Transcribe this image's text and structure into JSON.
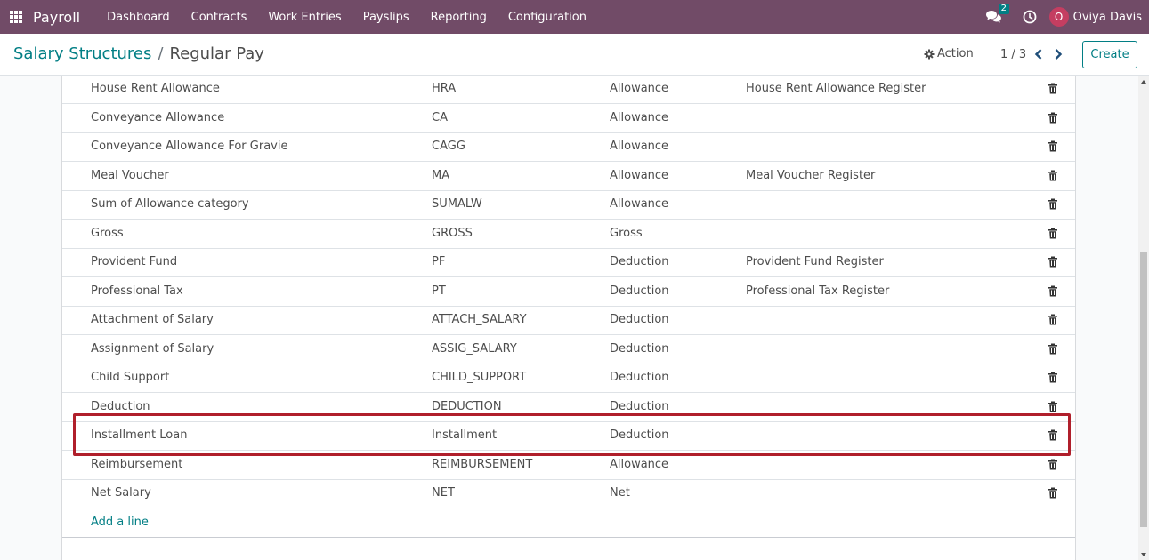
{
  "navbar": {
    "brand": "Payroll",
    "menu": [
      "Dashboard",
      "Contracts",
      "Work Entries",
      "Payslips",
      "Reporting",
      "Configuration"
    ],
    "chat_count": "2",
    "user_initial": "O",
    "user_name": "Oviya Davis"
  },
  "control_panel": {
    "breadcrumb_parent": "Salary Structures",
    "breadcrumb_separator": "/",
    "breadcrumb_current": "Regular Pay",
    "action_label": "Action",
    "pager": "1 / 3",
    "create_label": "Create"
  },
  "rules": [
    {
      "name": "House Rent Allowance",
      "code": "HRA",
      "category": "Allowance",
      "register": "House Rent Allowance Register"
    },
    {
      "name": "Conveyance Allowance",
      "code": "CA",
      "category": "Allowance",
      "register": ""
    },
    {
      "name": "Conveyance Allowance For Gravie",
      "code": "CAGG",
      "category": "Allowance",
      "register": ""
    },
    {
      "name": "Meal Voucher",
      "code": "MA",
      "category": "Allowance",
      "register": "Meal Voucher Register"
    },
    {
      "name": "Sum of Allowance category",
      "code": "SUMALW",
      "category": "Allowance",
      "register": ""
    },
    {
      "name": "Gross",
      "code": "GROSS",
      "category": "Gross",
      "register": ""
    },
    {
      "name": "Provident Fund",
      "code": "PF",
      "category": "Deduction",
      "register": "Provident Fund Register"
    },
    {
      "name": "Professional Tax",
      "code": "PT",
      "category": "Deduction",
      "register": "Professional Tax Register"
    },
    {
      "name": "Attachment of Salary",
      "code": "ATTACH_SALARY",
      "category": "Deduction",
      "register": ""
    },
    {
      "name": "Assignment of Salary",
      "code": "ASSIG_SALARY",
      "category": "Deduction",
      "register": ""
    },
    {
      "name": "Child Support",
      "code": "CHILD_SUPPORT",
      "category": "Deduction",
      "register": ""
    },
    {
      "name": "Deduction",
      "code": "DEDUCTION",
      "category": "Deduction",
      "register": ""
    },
    {
      "name": "Installment Loan",
      "code": "Installment",
      "category": "Deduction",
      "register": ""
    },
    {
      "name": "Reimbursement",
      "code": "REIMBURSEMENT",
      "category": "Allowance",
      "register": ""
    },
    {
      "name": "Net Salary",
      "code": "NET",
      "category": "Net",
      "register": ""
    }
  ],
  "add_line_label": "Add a line",
  "colors": {
    "navbar": "#714b67",
    "accent": "#017e84",
    "highlight": "#b01f2b"
  },
  "icons": {
    "apps": "apps-grid-icon",
    "chat": "chat-icon",
    "clock": "clock-icon",
    "gear": "gear-icon",
    "prev": "chevron-left-icon",
    "next": "chevron-right-icon",
    "delete": "trash-icon"
  }
}
